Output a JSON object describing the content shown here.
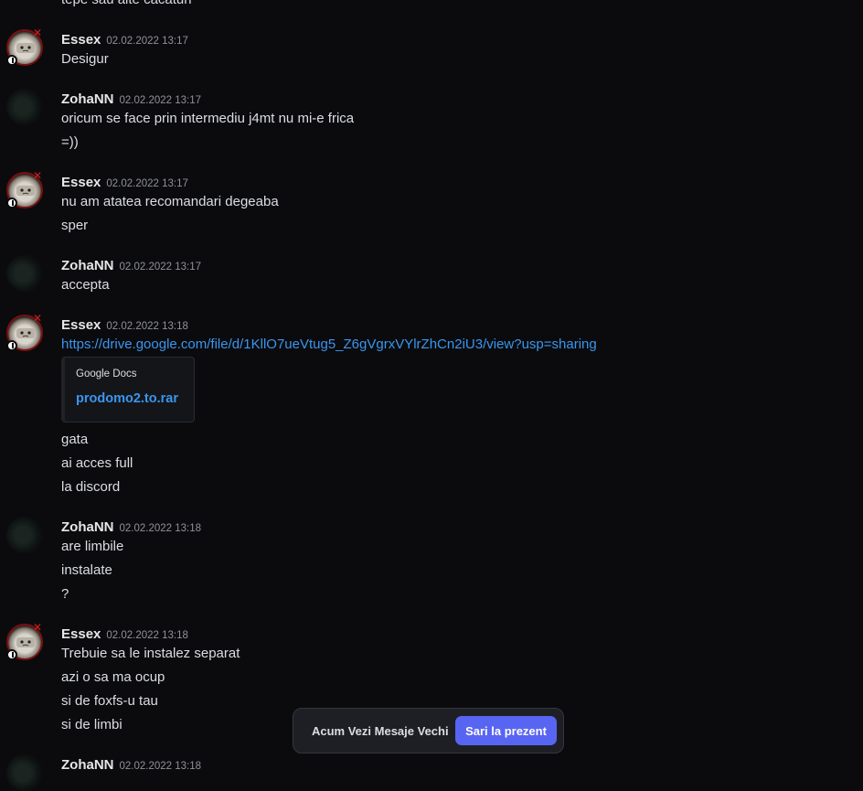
{
  "top_partial_text": "tepe sau alte cacaturi",
  "messages": [
    {
      "author": "Essex",
      "time": "02.02.2022 13:17",
      "lines": [
        "Desigur"
      ]
    },
    {
      "author": "ZohaNN",
      "time": "02.02.2022 13:17",
      "lines": [
        "oricum se face prin intermediu j4mt nu mi-e frica",
        "=))"
      ]
    },
    {
      "author": "Essex",
      "time": "02.02.2022 13:17",
      "lines": [
        "nu am atatea recomandari degeaba",
        "sper"
      ]
    },
    {
      "author": "ZohaNN",
      "time": "02.02.2022 13:17",
      "lines": [
        "accepta"
      ]
    },
    {
      "author": "Essex",
      "time": "02.02.2022 13:18",
      "link": "https://drive.google.com/file/d/1KllO7ueVtug5_Z6gVgrxVYlrZhCn2iU3/view?usp=sharing",
      "embed": {
        "provider": "Google Docs",
        "title": "prodomo2.to.rar"
      },
      "lines": [
        "gata",
        "ai acces full",
        "la discord"
      ]
    },
    {
      "author": "ZohaNN",
      "time": "02.02.2022 13:18",
      "lines": [
        "are limbile",
        "instalate",
        "?"
      ]
    },
    {
      "author": "Essex",
      "time": "02.02.2022 13:18",
      "lines": [
        "Trebuie sa le instalez separat",
        "azi o sa ma ocup",
        "si de foxfs-u tau",
        "si de limbi"
      ]
    },
    {
      "author": "ZohaNN",
      "time": "02.02.2022 13:18",
      "lines": []
    }
  ],
  "jump_bar": {
    "label": "Acum Vezi Mesaje Vechi",
    "button": "Sari la prezent",
    "button_color": "#5865f2"
  },
  "colors": {
    "background": "#0b0b0e",
    "link": "#3a96ee"
  }
}
